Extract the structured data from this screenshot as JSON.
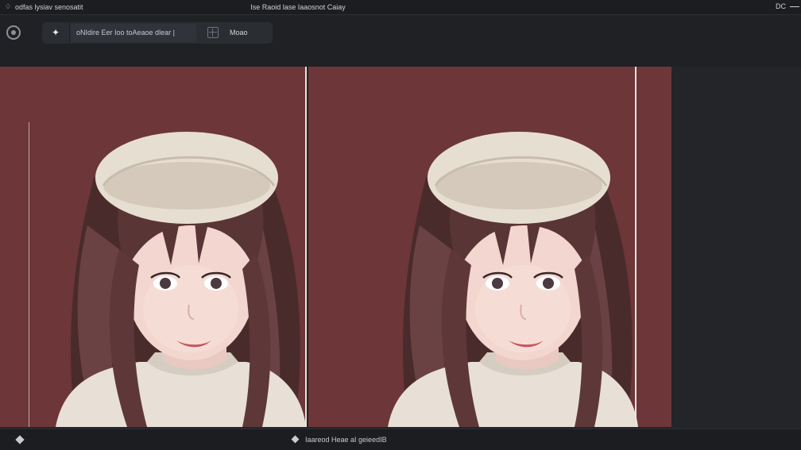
{
  "titlebar": {
    "app_name": "odfas lysiav senosatit",
    "window_title": "Ise Raoid lase Iaaosnot Caiay",
    "restore_label": "DC"
  },
  "toolbar": {
    "prompt_text": "oNIdire Eer Ioo toAeaoe dlear",
    "prompt_cursor": "|",
    "mode_label": "Moao"
  },
  "status": {
    "text": "Iaareod Heae aI geieedIB"
  },
  "colors": {
    "backdrop": "#6d3639",
    "divider": "#e8e2e2",
    "chrome": "#1f2124"
  },
  "icons": {
    "app": "app-logo-icon",
    "target": "target-icon",
    "spark": "sparkle-icon",
    "grid": "grid-icon",
    "status_left": "diamond-icon",
    "status_text": "diamond-icon"
  }
}
